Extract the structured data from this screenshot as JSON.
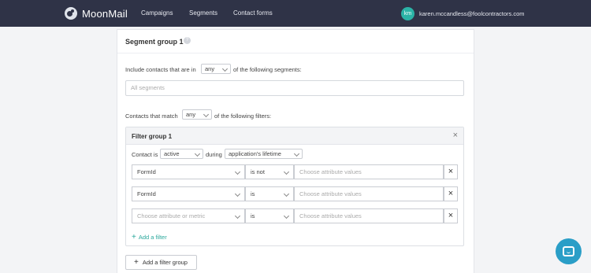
{
  "navbar": {
    "brand": "MoonMail",
    "links": [
      "Campaigns",
      "Segments",
      "Contact forms"
    ],
    "user": {
      "initials": "km",
      "email": "karen.mccandless@foolcontractors.com"
    }
  },
  "segment": {
    "title": "Segment group 1",
    "help": "?",
    "include_prefix": "Include contacts that are in",
    "include_select": "any",
    "include_suffix": "of the following segments:",
    "segments_placeholder": "All segments",
    "match_prefix": "Contacts that match",
    "match_select": "any",
    "match_suffix": "of the following filters:"
  },
  "filter_group": {
    "title": "Filter group 1",
    "close": "×",
    "contact_is_label": "Contact is",
    "status_select": "active",
    "during_label": "during",
    "lifetime_select": "application's lifetime",
    "rows": [
      {
        "attribute": "FormId",
        "attribute_placeholder": false,
        "operator": "is not",
        "value_placeholder": "Choose attribute values"
      },
      {
        "attribute": "FormId",
        "attribute_placeholder": false,
        "operator": "is",
        "value_placeholder": "Choose attribute values"
      },
      {
        "attribute": "Choose attribute or metric",
        "attribute_placeholder": true,
        "operator": "is",
        "value_placeholder": "Choose attribute values"
      }
    ],
    "remove": "×",
    "add_filter": "Add a filter"
  },
  "add_group": "Add a filter group",
  "chat_icon": "chat-bubble-icon"
}
